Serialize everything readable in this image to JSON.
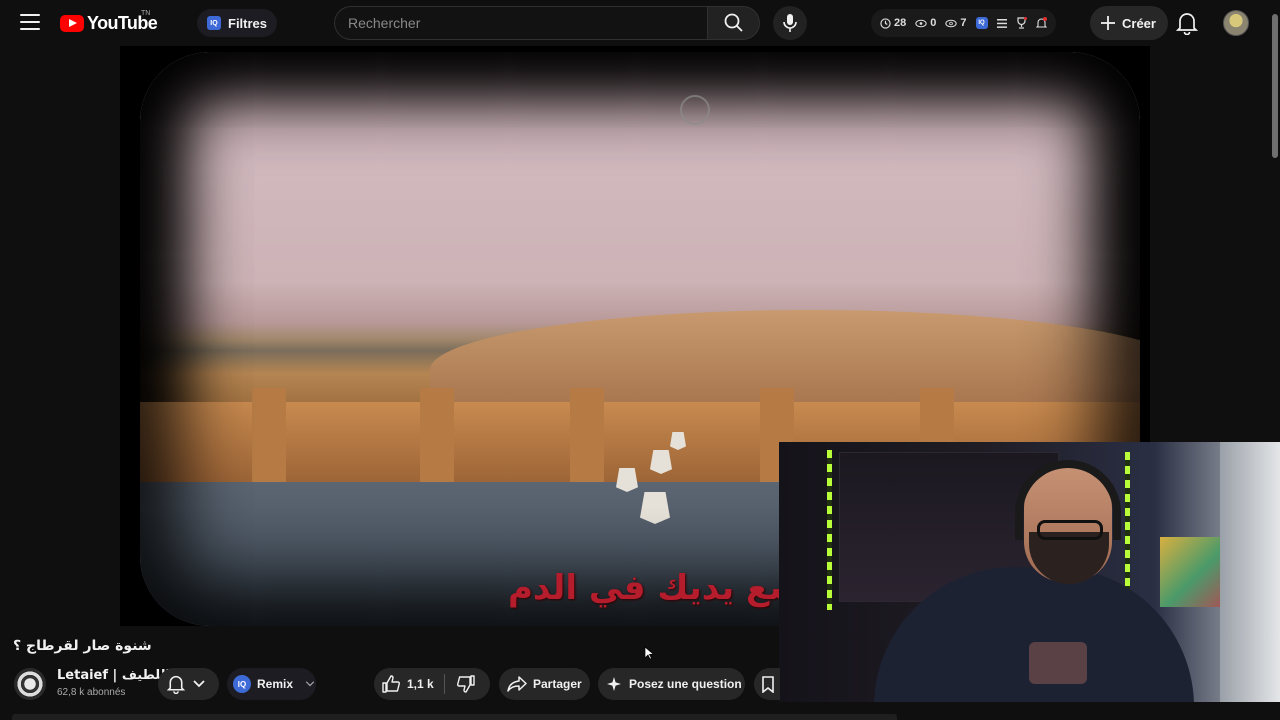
{
  "header": {
    "logo_text": "YouTube",
    "logo_sup": "TN",
    "filters_label": "Filtres",
    "iq_label": "IQ",
    "search_placeholder": "Rechercher",
    "stats": {
      "history": "28",
      "watched": "0",
      "viewed": "7"
    },
    "create_label": "Créer"
  },
  "video": {
    "subtitle": "ضع يديك في الدم"
  },
  "details": {
    "title": "شنوة صار لقرطاج ؟",
    "channel_name": "Letaief | اللطيف",
    "subscribers": "62,8 k abonnés",
    "remix_label": "Remix",
    "likes": "1,1 k",
    "share_label": "Partager",
    "ask_label": "Posez une question"
  },
  "colors": {
    "background": "#0f0f0f",
    "accent_red": "#ff0000",
    "iq_blue": "#3e6ad8",
    "subtitle_red": "#b51c2c"
  }
}
